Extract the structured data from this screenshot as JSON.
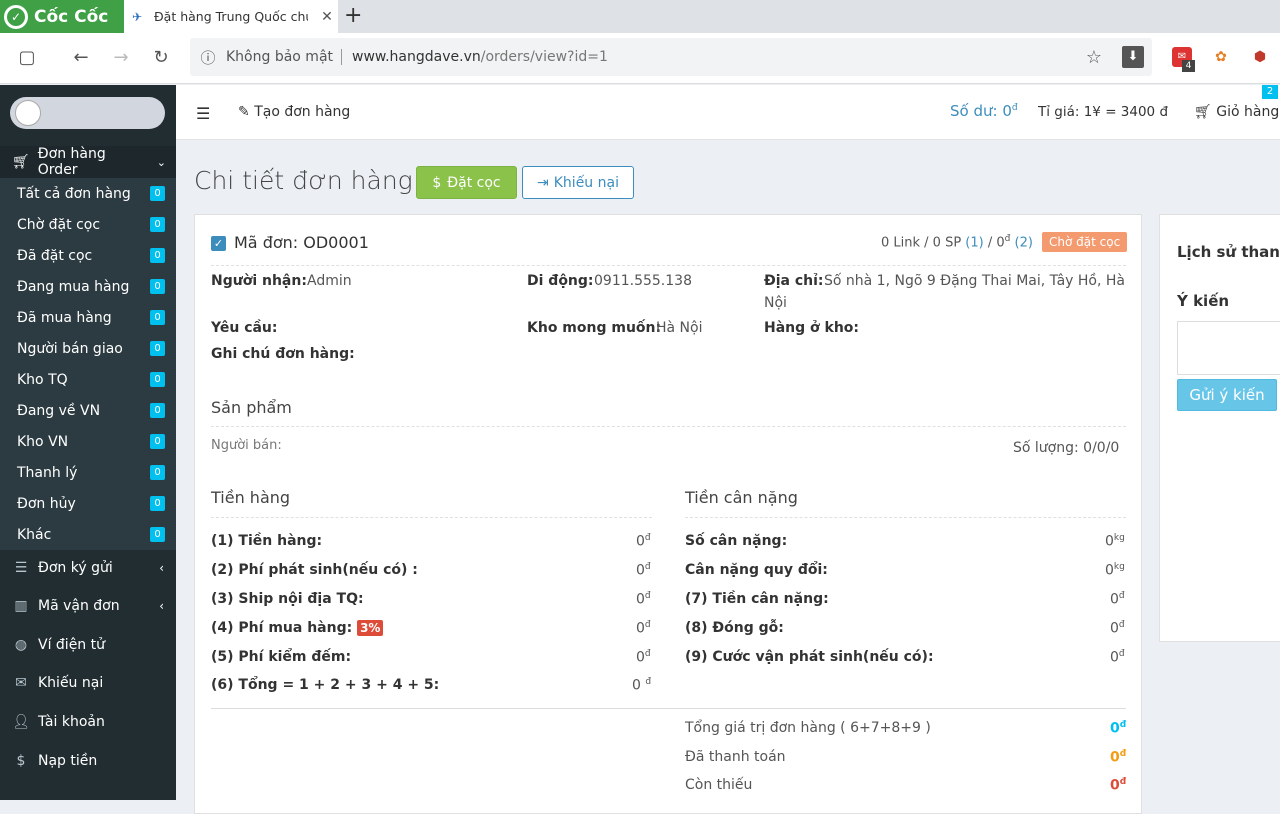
{
  "browser": {
    "brand": "Cốc Cốc",
    "tab_title": "Đặt hàng Trung Quốc chu",
    "insecure_label": "Không bảo mật",
    "url_domain": "www.hangdave.vn",
    "url_path": "/orders/view?id=1",
    "ext_badge": "4"
  },
  "header": {
    "create_order": "Tạo đơn hàng",
    "balance_label": "Số dư: 0",
    "balance_unit": "đ",
    "rate": "Tỉ giá: 1¥ = 3400 đ",
    "cart": "Giỏ hàng",
    "cart_count": "2"
  },
  "sidebar": {
    "group": "Đơn hàng Order",
    "sub_items": [
      {
        "label": "Tất cả đơn hàng",
        "count": "0"
      },
      {
        "label": "Chờ đặt cọc",
        "count": "0"
      },
      {
        "label": "Đã đặt cọc",
        "count": "0"
      },
      {
        "label": "Đang mua hàng",
        "count": "0"
      },
      {
        "label": "Đã mua hàng",
        "count": "0"
      },
      {
        "label": "Người bán giao",
        "count": "0"
      },
      {
        "label": "Kho TQ",
        "count": "0"
      },
      {
        "label": "Đang về VN",
        "count": "0"
      },
      {
        "label": "Kho VN",
        "count": "0"
      },
      {
        "label": "Thanh lý",
        "count": "0"
      },
      {
        "label": "Đơn hủy",
        "count": "0"
      },
      {
        "label": "Khác",
        "count": "0"
      }
    ],
    "items": [
      {
        "label": "Đơn ký gửi"
      },
      {
        "label": "Mã vận đơn"
      },
      {
        "label": "Ví điện tử"
      },
      {
        "label": "Khiếu nại"
      },
      {
        "label": "Tài khoản"
      },
      {
        "label": "Nạp tiền"
      }
    ]
  },
  "page": {
    "title": "Chi tiết đơn hàng",
    "deposit_button": "Đặt cọc",
    "complaint_button": "Khiếu nại"
  },
  "order": {
    "code_label": "Mã đơn: OD0001",
    "summary_a": "0 Link / 0 SP ",
    "summary_b": "(1)",
    "summary_c": " / 0",
    "summary_unit": "đ",
    "summary_d": " (2)",
    "status": "Chờ đặt cọc",
    "recipient_label": "Người nhận:",
    "recipient": "Admin",
    "phone_label": "Di động:",
    "phone": "0911.555.138",
    "address_label": "Địa chỉ:",
    "address_line1": "Số nhà 1, Ngõ 9 Đặng Thai Mai, Tây Hồ, Hà",
    "address_line2": "Nội",
    "request_label": "Yêu cầu:",
    "warehouse_label": "Kho mong muốn:",
    "warehouse": "Hà Nội",
    "in_stock_label": "Hàng ở kho:",
    "note_label": "Ghi chú đơn hàng:",
    "products_title": "Sản phẩm",
    "seller_label": "Người bán:",
    "quantity": "Số lượng: 0/0/0"
  },
  "costs": {
    "goods_title": "Tiền hàng",
    "weight_title": "Tiền cân nặng",
    "goods": [
      {
        "label": "(1) Tiền hàng:",
        "value": "0",
        "unit": "đ"
      },
      {
        "label": "(2) Phí phát sinh(nếu có) :",
        "value": "0",
        "unit": "đ"
      },
      {
        "label": "(3) Ship nội địa TQ:",
        "value": "0",
        "unit": "đ"
      },
      {
        "label": "(4) Phí mua hàng:",
        "value": "0",
        "unit": "đ",
        "badge": "3%"
      },
      {
        "label": "(5) Phí kiểm đếm:",
        "value": "0",
        "unit": "đ"
      },
      {
        "label": "(6) Tổng = 1 + 2 + 3 + 4 + 5:",
        "value": "0 ",
        "unit": "đ"
      }
    ],
    "weight": [
      {
        "label": "Số cân nặng:",
        "value": "0",
        "unit": "kg"
      },
      {
        "label": "Cân nặng quy đổi:",
        "value": "0",
        "unit": "kg"
      },
      {
        "label": "(7) Tiền cân nặng:",
        "value": "0",
        "unit": "đ"
      },
      {
        "label": "(8) Đóng gỗ:",
        "value": "0",
        "unit": "đ"
      },
      {
        "label": "(9) Cước vận phát sinh(nếu có):",
        "value": "0",
        "unit": "đ"
      }
    ],
    "totals": [
      {
        "label": "Tổng giá trị đơn hàng ( 6+7+8+9 )",
        "value": "0",
        "unit": "đ",
        "color": "#00c0ef"
      },
      {
        "label": "Đã thanh toán",
        "value": "0",
        "unit": "đ",
        "color": "#f39c12"
      },
      {
        "label": "Còn thiếu",
        "value": "0",
        "unit": "đ",
        "color": "#dd4b39"
      }
    ]
  },
  "right_panel": {
    "history_title": "Lịch sử thanh",
    "feedback_title": "Ý kiến",
    "send_button": "Gửi ý kiến"
  }
}
